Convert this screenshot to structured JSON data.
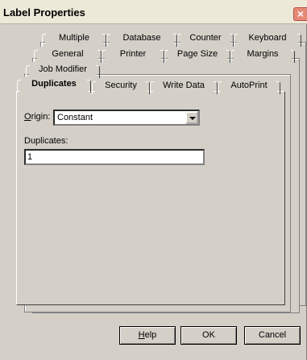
{
  "window": {
    "title": "Label Properties",
    "close_glyph": "×"
  },
  "tabs": {
    "row1": [
      "Multiple",
      "Database",
      "Counter",
      "Keyboard"
    ],
    "row2": [
      "General",
      "Printer",
      "Page Size",
      "Margins"
    ],
    "row3": [
      "Job Modifier"
    ],
    "row4": [
      "Duplicates",
      "Security",
      "Write Data",
      "AutoPrint"
    ],
    "active": "Duplicates"
  },
  "form": {
    "origin_label_first": "O",
    "origin_label_rest": "rigin:",
    "origin_value": "Constant",
    "duplicates_label": "Duplicates:",
    "duplicates_value": "1"
  },
  "buttons": {
    "help_first": "H",
    "help_rest": "elp",
    "ok": "OK",
    "cancel": "Cancel"
  }
}
